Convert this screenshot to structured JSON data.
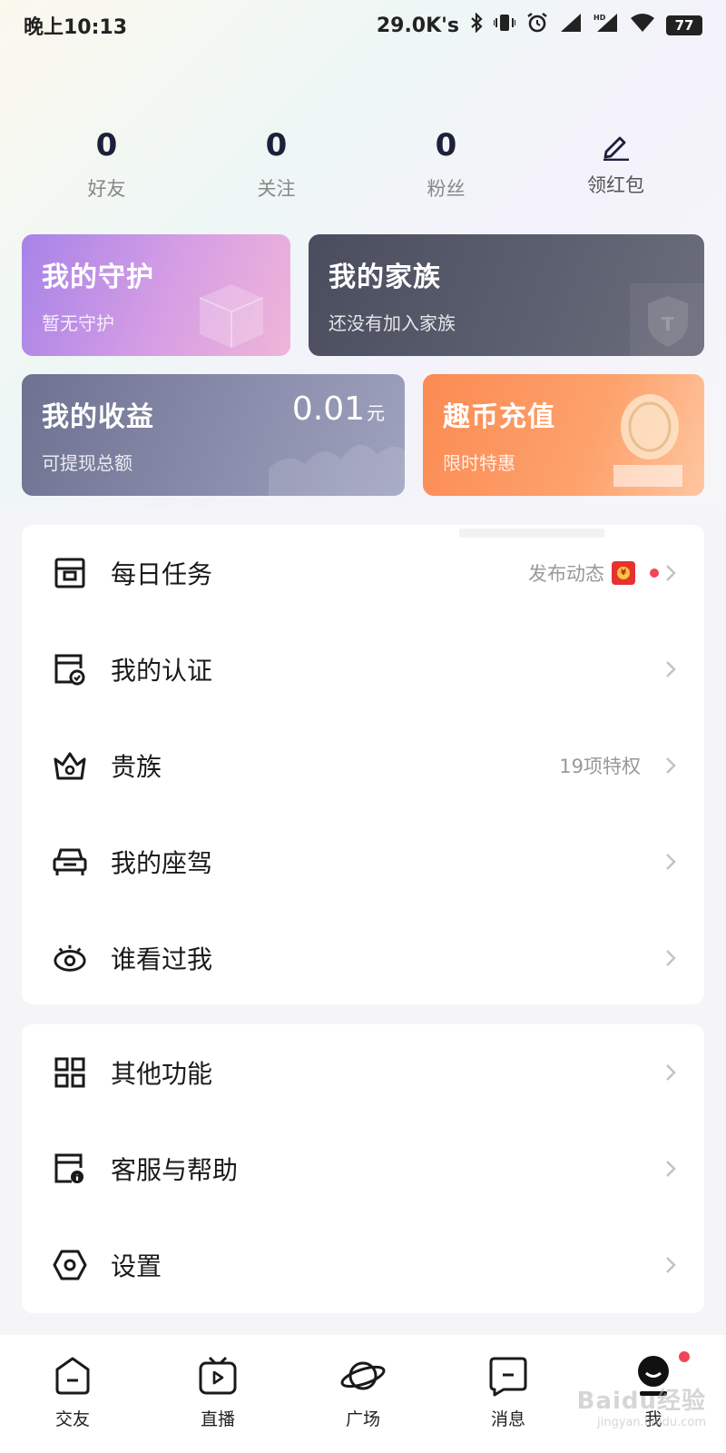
{
  "status_bar": {
    "time": "晚上10:13",
    "network_speed": "29.0K's",
    "battery": "77",
    "icons": [
      "bluetooth-icon",
      "vibrate-icon",
      "alarm-icon",
      "signal-icon",
      "hd-signal-icon",
      "wifi-icon",
      "battery-icon"
    ]
  },
  "stats": {
    "friends": {
      "value": "0",
      "label": "好友"
    },
    "following": {
      "value": "0",
      "label": "关注"
    },
    "fans": {
      "value": "0",
      "label": "粉丝"
    },
    "red_packet": {
      "label": "领红包",
      "icon": "pencil-icon"
    }
  },
  "cards": {
    "guard": {
      "title": "我的守护",
      "sub": "暂无守护"
    },
    "family": {
      "title": "我的家族",
      "sub": "还没有加入家族"
    },
    "income": {
      "title": "我的收益",
      "sub": "可提现总额",
      "amount": "0.01",
      "unit": "元"
    },
    "recharge": {
      "title": "趣币充值",
      "sub": "限时特惠"
    }
  },
  "menu": {
    "daily_task": {
      "label": "每日任务",
      "extra": "发布动态",
      "icon": "task-icon"
    },
    "certification": {
      "label": "我的认证",
      "icon": "certificate-icon"
    },
    "nobility": {
      "label": "贵族",
      "extra": "19项特权",
      "icon": "crown-icon"
    },
    "vehicle": {
      "label": "我的座驾",
      "icon": "car-icon"
    },
    "visitors": {
      "label": "谁看过我",
      "icon": "eye-icon"
    },
    "other": {
      "label": "其他功能",
      "icon": "grid-icon"
    },
    "help": {
      "label": "客服与帮助",
      "icon": "help-icon"
    },
    "settings": {
      "label": "设置",
      "icon": "settings-icon"
    }
  },
  "bottom_nav": {
    "friends": "交友",
    "live": "直播",
    "square": "广场",
    "messages": "消息",
    "me": "我"
  },
  "watermark": {
    "text": "Baidu经验",
    "sub": "jingyan.baidu.com"
  },
  "colors": {
    "accent_red": "#f2455c",
    "guard_card": "#a783e8",
    "family_card": "#4a4d5e",
    "income_card": "#6e7291",
    "recharge_card": "#fb8a53"
  }
}
